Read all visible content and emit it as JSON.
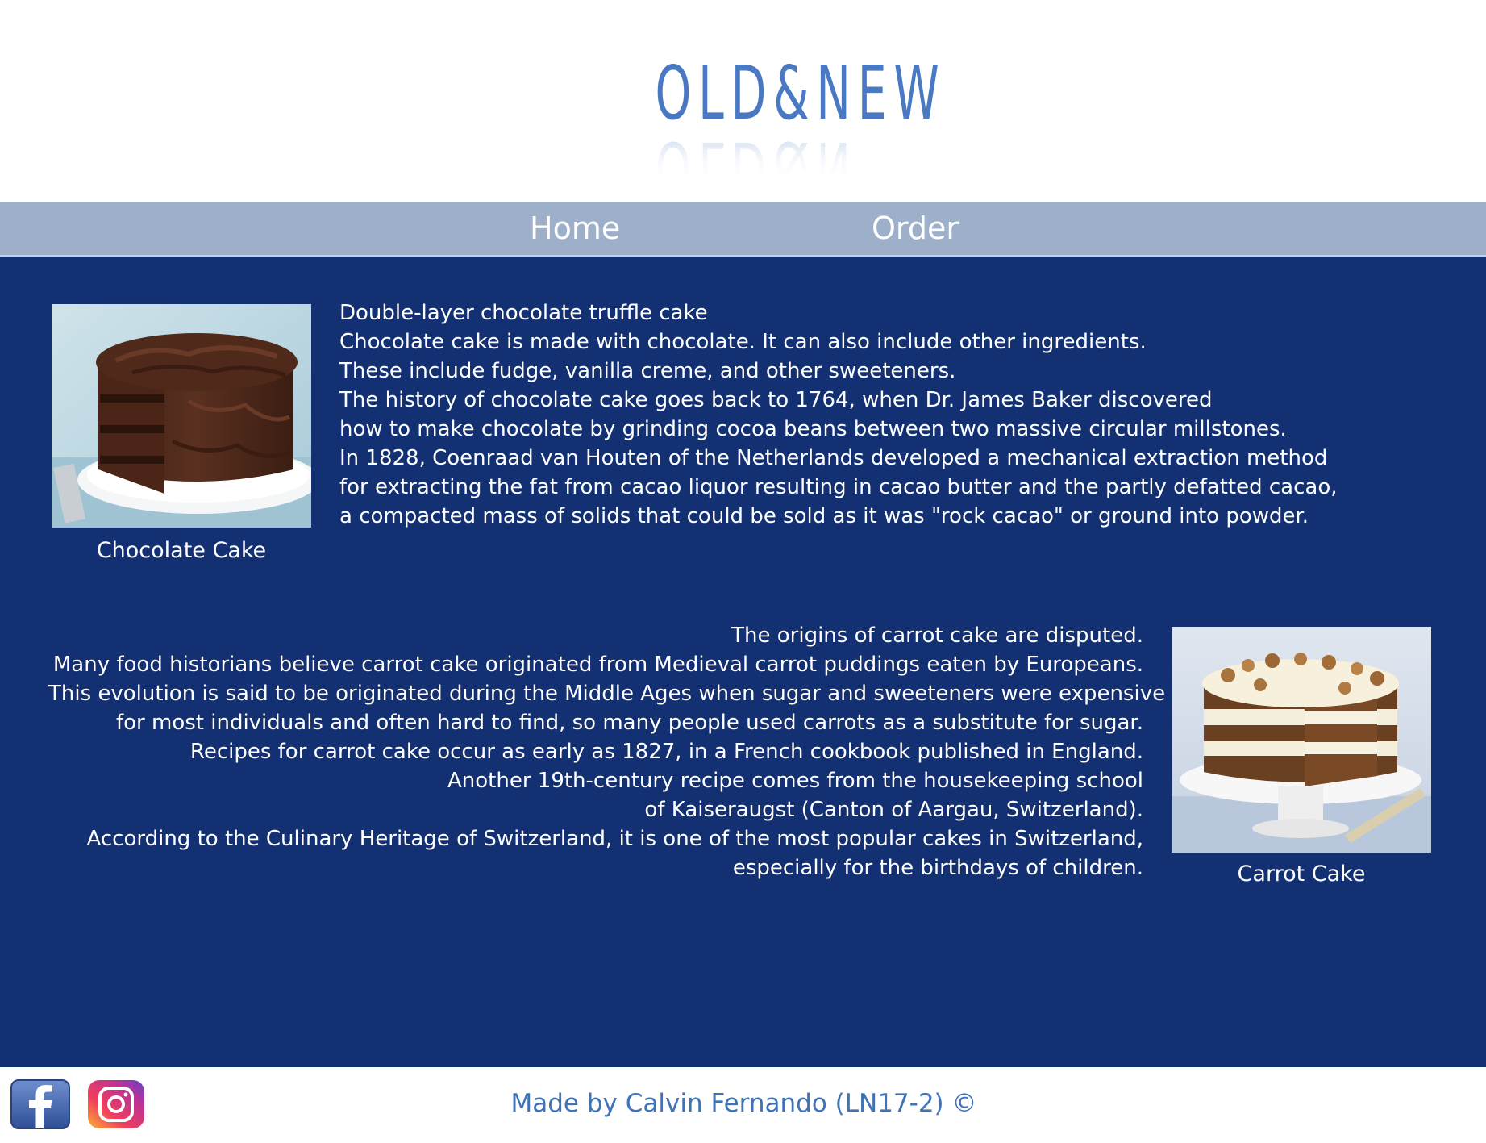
{
  "header": {
    "logo_text": "OLD&NEW"
  },
  "nav": {
    "items": [
      {
        "label": "Home"
      },
      {
        "label": "Order"
      }
    ]
  },
  "sections": [
    {
      "image_icon": "chocolate-cake-photo",
      "caption": "Chocolate Cake",
      "lines": [
        "Double-layer chocolate truffle cake",
        "Chocolate cake is made with chocolate. It can also include other ingredients.",
        "These include fudge, vanilla creme, and other sweeteners.",
        "The history of chocolate cake goes back to 1764, when Dr. James Baker discovered",
        "how to make chocolate by grinding cocoa beans between two massive circular millstones.",
        "In 1828, Coenraad van Houten of the Netherlands developed a mechanical extraction method",
        "for extracting the fat from cacao liquor resulting in cacao butter and the partly defatted cacao,",
        "a compacted mass of solids that could be sold as it was \"rock cacao\" or ground into powder."
      ]
    },
    {
      "image_icon": "carrot-cake-photo",
      "caption": "Carrot Cake",
      "lines": [
        "The origins of carrot cake are disputed.",
        "Many food historians believe carrot cake originated from Medieval carrot puddings eaten by Europeans.",
        "This evolution is said to be originated during the Middle Ages when sugar and sweeteners were expensive",
        "for most individuals and often hard to find, so many people used carrots as a substitute for sugar.",
        "Recipes for carrot cake occur as early as 1827, in a French cookbook published in England.",
        "Another 19th-century recipe comes from the housekeeping school",
        "of Kaiseraugst (Canton of Aargau, Switzerland).",
        "According to the Culinary Heritage of Switzerland, it is one of the most popular cakes in Switzerland,",
        "especially for the birthdays of children."
      ]
    }
  ],
  "footer": {
    "social": [
      {
        "icon": "facebook-icon"
      },
      {
        "icon": "instagram-icon"
      }
    ],
    "credit": "Made by Calvin Fernando (LN17-2) ©"
  },
  "colors": {
    "main_bg": "#133072",
    "nav_bg": "#9dafc9",
    "logo": "#4a79c4",
    "credit": "#3f73b8"
  }
}
